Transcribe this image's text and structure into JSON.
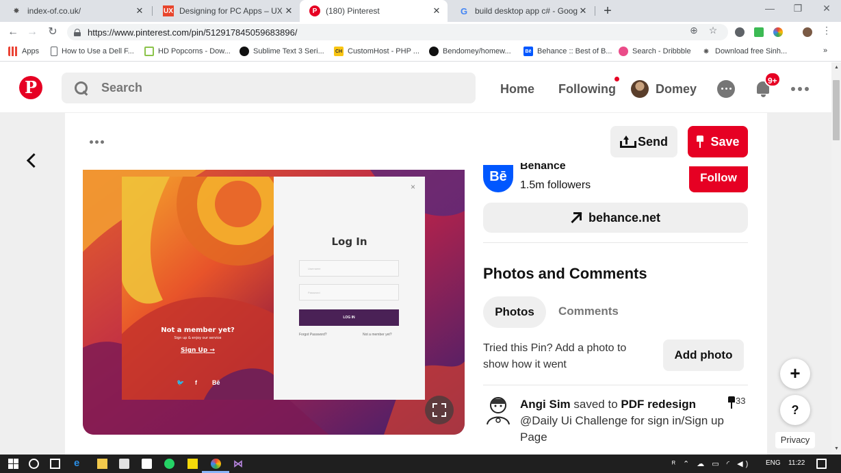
{
  "browser": {
    "tabs": [
      {
        "title": "index-of.co.uk/",
        "icon": "spider-icon",
        "active": false
      },
      {
        "title": "Designing for PC Apps – UX Plan",
        "icon": "ux-icon",
        "active": false
      },
      {
        "title": "(180) Pinterest",
        "icon": "pinterest-icon",
        "active": true
      },
      {
        "title": "build desktop app c# - Google S",
        "icon": "google-icon",
        "active": false
      }
    ],
    "url": "https://www.pinterest.com/pin/512917845059683896/",
    "bookmarks": [
      {
        "label": "Apps",
        "icon": "apps-grid-icon"
      },
      {
        "label": "How to Use a Dell F...",
        "icon": "page-icon"
      },
      {
        "label": "HD Popcorns - Dow...",
        "icon": "film-icon"
      },
      {
        "label": "Sublime Text 3 Seri...",
        "icon": "github-icon"
      },
      {
        "label": "CustomHost - PHP ...",
        "icon": "ch-icon"
      },
      {
        "label": "Bendomey/homew...",
        "icon": "github-icon"
      },
      {
        "label": "Behance :: Best of B...",
        "icon": "behance-icon"
      },
      {
        "label": "Search - Dribbble",
        "icon": "dribbble-icon"
      },
      {
        "label": "Download free Sinh...",
        "icon": "sinhala-icon"
      }
    ],
    "bookmarks_overflow": "»"
  },
  "header": {
    "logo": "P",
    "search_placeholder": "Search",
    "nav": {
      "home": "Home",
      "following": "Following",
      "user": "Domey"
    },
    "notifications_badge": "9+",
    "accent": "#e60023"
  },
  "pin": {
    "send_label": "Send",
    "save_label": "Save",
    "image": {
      "login_title": "Log In",
      "username_placeholder": "Username",
      "password_placeholder": "Password",
      "login_button": "LOG IN",
      "forgot": "Forgot Password?",
      "not_member_small": "Not a member yet?",
      "not_member": "Not a member yet?",
      "signup_tagline": "Sign up & enjoy our service",
      "signup_link": "Sign Up →",
      "close": "×",
      "social": [
        "🐦",
        "f",
        "Bē"
      ]
    },
    "source": {
      "name": "Behance",
      "followers": "1.5m followers",
      "follow_label": "Follow",
      "link_label": "behance.net",
      "logo_text": "Bē"
    },
    "photos_comments": {
      "heading": "Photos and Comments",
      "tab_photos": "Photos",
      "tab_comments": "Comments",
      "tried_text": "Tried this Pin? Add a photo to show how it went",
      "add_photo": "Add photo"
    },
    "activity": {
      "user": "Angi Sim",
      "action": " saved to ",
      "board": "PDF redesign",
      "description": "@Daily Ui Challenge for sign in/Sign up Page",
      "pins": "33"
    }
  },
  "floating": {
    "plus": "+",
    "help": "?",
    "privacy": "Privacy"
  },
  "taskbar": {
    "language": "ENG",
    "time": "11:22",
    "system_glyphs": "ᴿ ⌃ ☁ ▭ ◜ ◀)"
  }
}
